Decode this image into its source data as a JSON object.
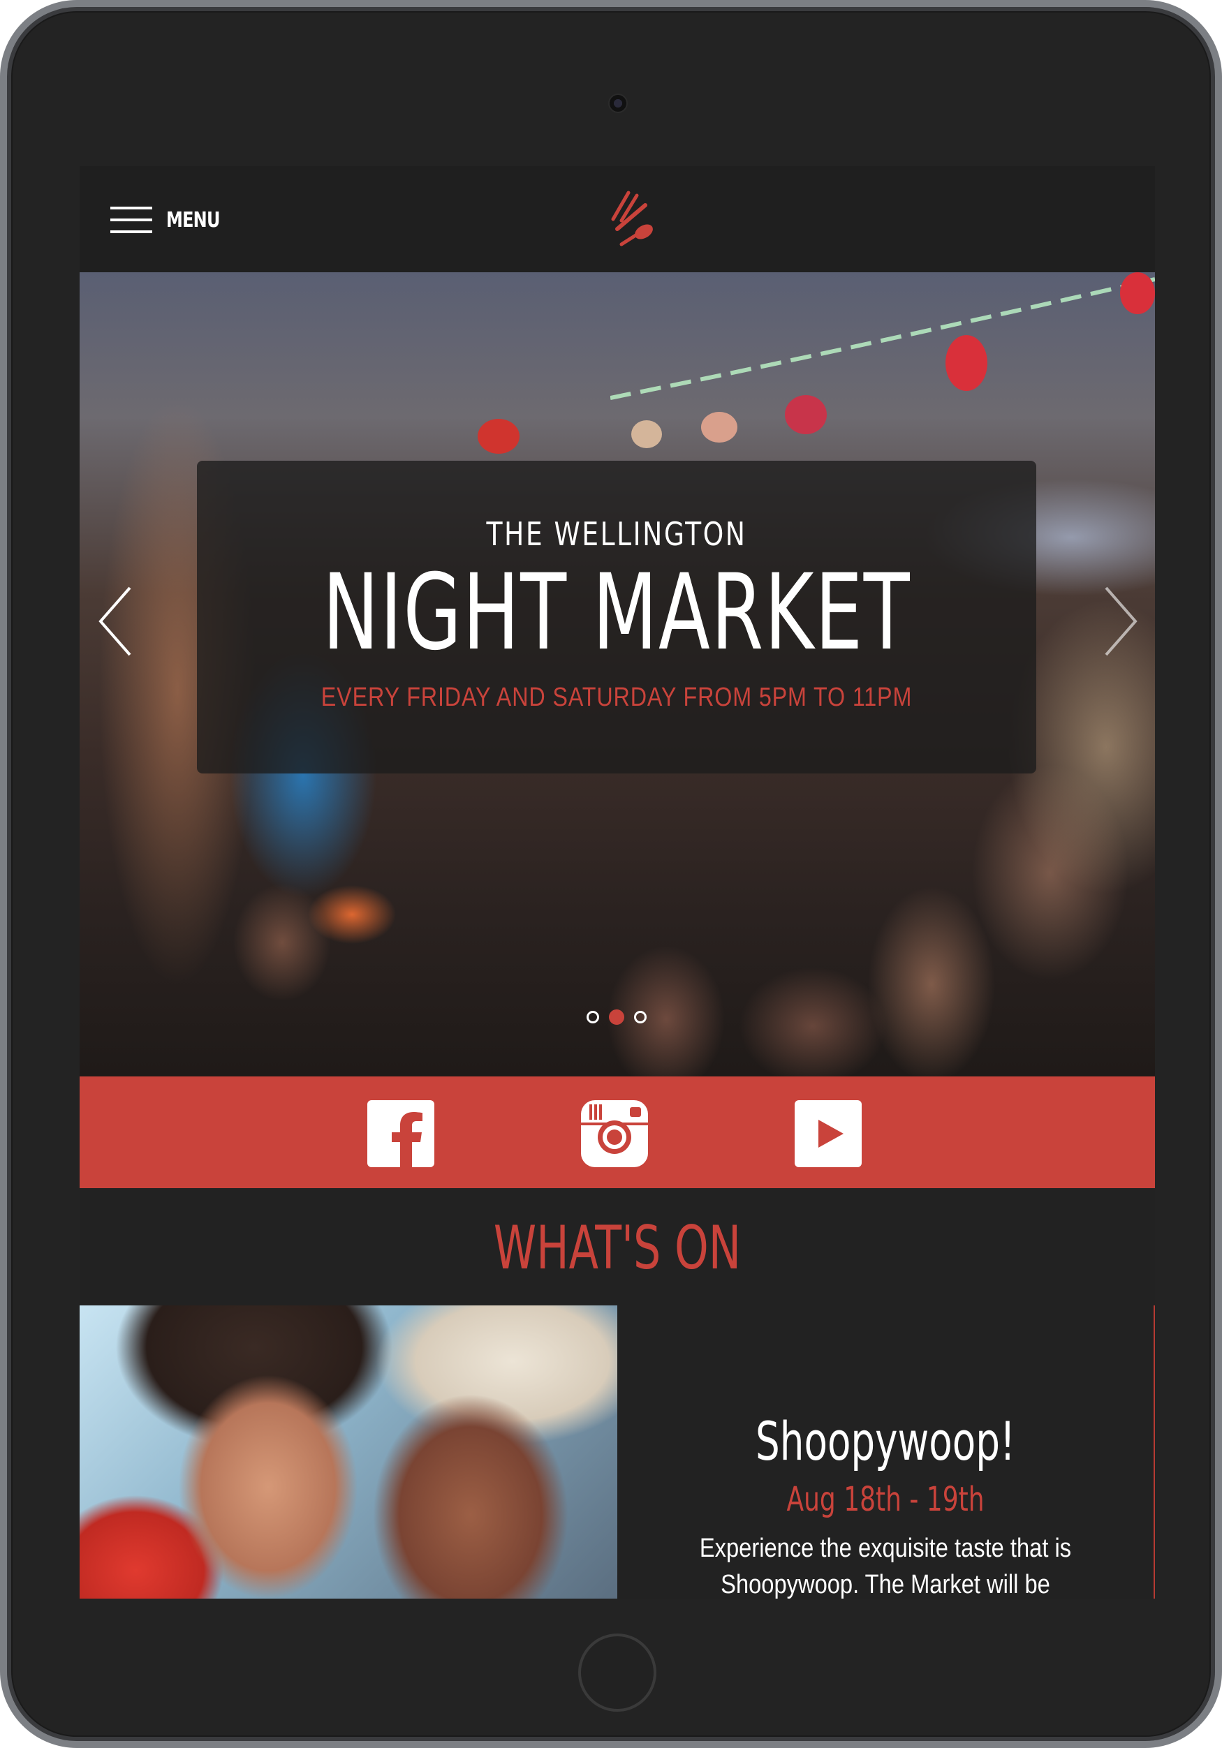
{
  "header": {
    "menu_label": "MENU"
  },
  "hero": {
    "kicker": "THE WELLINGTON",
    "title": "NIGHT MARKET",
    "subtitle": "EVERY FRIDAY AND SATURDAY FROM 5PM TO 11PM",
    "slides": 3,
    "active_slide": 2
  },
  "social": {
    "items": [
      "facebook",
      "instagram",
      "youtube"
    ]
  },
  "whats_on": {
    "title": "WHAT'S ON",
    "event": {
      "name": "Shoopywoop!",
      "dates": "Aug 18th - 19th",
      "description": "Experience the exquisite taste that is Shoopywoop. The Market will be showcasing"
    }
  },
  "colors": {
    "accent": "#c9433b",
    "background": "#222222",
    "header": "#1f1f1f"
  }
}
